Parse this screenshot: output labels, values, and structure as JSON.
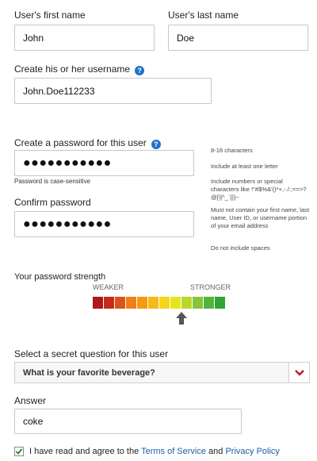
{
  "first_name": {
    "label": "User's first name",
    "value": "John"
  },
  "last_name": {
    "label": "User's last name",
    "value": "Doe"
  },
  "username": {
    "label": "Create his or her username",
    "help": "?",
    "value": "John.Doe112233"
  },
  "password": {
    "label": "Create a password for this user",
    "help": "?",
    "value": "●●●●●●●●●●●",
    "hint": "Password is case-sensitive"
  },
  "confirm_password": {
    "label": "Confirm password",
    "value": "●●●●●●●●●●●"
  },
  "rules": [
    "8-16 characters",
    "Include at least one letter",
    "Include numbers or special characters like !\"#$%&'()*+,-./:;<=>?@[\\]^_`{|}~",
    "Must not contain your first name, last name, User ID, or username portion of your email address",
    "Do not include spaces"
  ],
  "strength": {
    "label": "Your password strength",
    "weaker": "WEAKER",
    "stronger": "STRONGER",
    "level": 0.67,
    "colors": [
      "#b01818",
      "#c92a1e",
      "#d9531c",
      "#ef7f1a",
      "#f59a12",
      "#f6b916",
      "#f4d519",
      "#e3e51d",
      "#b8d72a",
      "#86c43a",
      "#52b53b",
      "#2fa537"
    ]
  },
  "secret_question": {
    "label": "Select a secret question for this user",
    "selected": "What is your favorite beverage?",
    "accent": "#c8102e"
  },
  "answer": {
    "label": "Answer",
    "value": "coke"
  },
  "agreement": {
    "prefix": "I have read and agree to the ",
    "tos": "Terms of Service",
    "and": " and ",
    "privacy": "Privacy Policy",
    "checked": true
  }
}
